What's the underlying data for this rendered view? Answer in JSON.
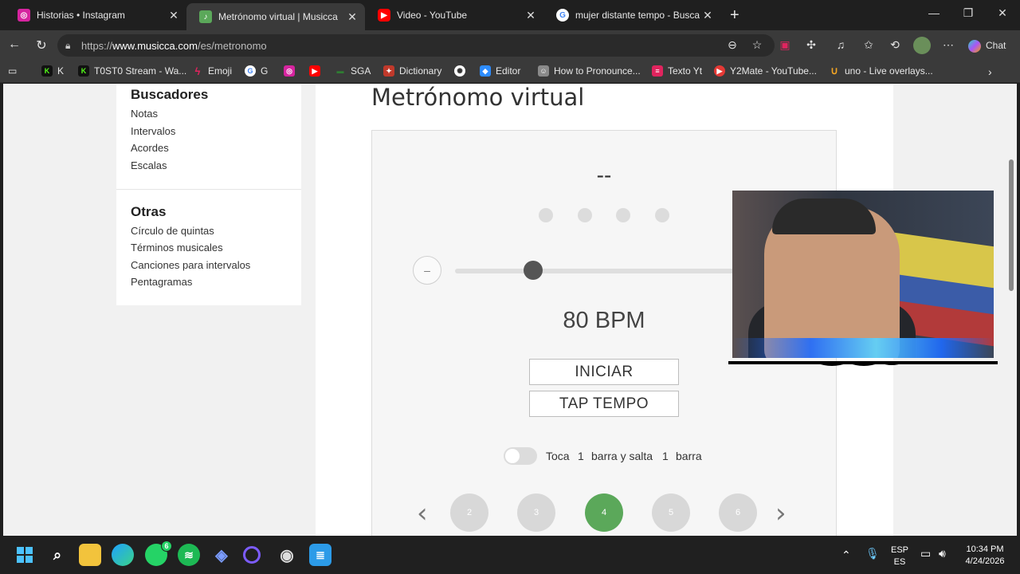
{
  "tabs": [
    {
      "title": "Historias • Instagram",
      "icon": "instagram-icon",
      "color": "#d6249f"
    },
    {
      "title": "Metrónomo virtual | Musicca",
      "icon": "musicca-icon",
      "color": "#5ba85a"
    },
    {
      "title": "Video - YouTube",
      "icon": "youtube-icon",
      "color": "#ff0000"
    },
    {
      "title": "mujer distante tempo - Buscar con",
      "icon": "google-icon",
      "color": "#4285f4"
    }
  ],
  "address": {
    "prefix": "https://",
    "domain": "www.musicca.com",
    "path": "/es/metronomo"
  },
  "toolbar": {
    "chat_label": "Chat"
  },
  "bookmarks": [
    {
      "label": "K",
      "icon": "kick-icon",
      "color": "#53fc18"
    },
    {
      "label": "T0ST0 Stream - Wa...",
      "icon": "kick-icon",
      "color": "#53fc18"
    },
    {
      "label": "Emoji",
      "icon": "bolt-icon",
      "color": "#e0245e"
    },
    {
      "label": "G",
      "icon": "google-icon",
      "color": "#4285f4"
    },
    {
      "label": "",
      "icon": "instagram-icon",
      "color": "#d6249f"
    },
    {
      "label": "",
      "icon": "youtube-icon",
      "color": "#ff0000"
    },
    {
      "label": "SGA",
      "icon": "sga-icon",
      "color": "#2e7d32"
    },
    {
      "label": "Dictionary",
      "icon": "dictionary-icon",
      "color": "#c0392b"
    },
    {
      "label": "",
      "icon": "openai-icon",
      "color": "#ffffff"
    },
    {
      "label": "Editor",
      "icon": "editor-icon",
      "color": "#2d8cff"
    },
    {
      "label": "How to Pronounce...",
      "icon": "pronounce-icon",
      "color": "#8a8a8a"
    },
    {
      "label": "Texto Yt",
      "icon": "texto-icon",
      "color": "#e0245e"
    },
    {
      "label": "Y2Mate - YouTube...",
      "icon": "y2mate-icon",
      "color": "#e53935"
    },
    {
      "label": "uno - Live overlays...",
      "icon": "uno-icon",
      "color": "#f5a623"
    }
  ],
  "sidebar": {
    "section1_title": "Buscadores",
    "section1_items": [
      "Notas",
      "Intervalos",
      "Acordes",
      "Escalas"
    ],
    "section2_title": "Otras",
    "section2_items": [
      "Círculo de quintas",
      "Términos musicales",
      "Canciones para intervalos",
      "Pentagramas"
    ]
  },
  "metronome": {
    "title": "Metrónomo virtual",
    "beat_display": "--",
    "minus_label": "–",
    "bpm_text": "80 BPM",
    "bpm": 80,
    "start_label": "INICIAR",
    "tap_label": "TAP TEMPO",
    "toggle_text_1": "Toca",
    "toggle_value_1": "1",
    "toggle_text_2": "barra y salta",
    "toggle_value_2": "1",
    "toggle_text_3": "barra",
    "beats_per_bar": [
      "2",
      "3",
      "4",
      "5",
      "6"
    ],
    "selected_beats": "4",
    "accent_color": "#5ba85a"
  },
  "taskbar": {
    "lang_top": "ESP",
    "lang_bottom": "ES",
    "time": "10:34 PM",
    "date": "4/24/2026",
    "whatsapp_badge": "6"
  }
}
